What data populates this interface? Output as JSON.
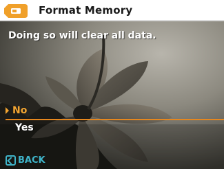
{
  "header": {
    "icon": "memory-card-tag-icon",
    "title": "Format Memory"
  },
  "dialog": {
    "message": "Doing so will clear all data.",
    "options": [
      {
        "label": "No",
        "selected": true
      },
      {
        "label": "Yes",
        "selected": false
      }
    ]
  },
  "footer": {
    "back_icon": "back-arrow-icon",
    "back_label": "BACK"
  },
  "colors": {
    "header_bg": "#ffffff",
    "header_icon": "#f0a02a",
    "highlight": "#f3a531",
    "back_accent": "#3fb4c9"
  }
}
